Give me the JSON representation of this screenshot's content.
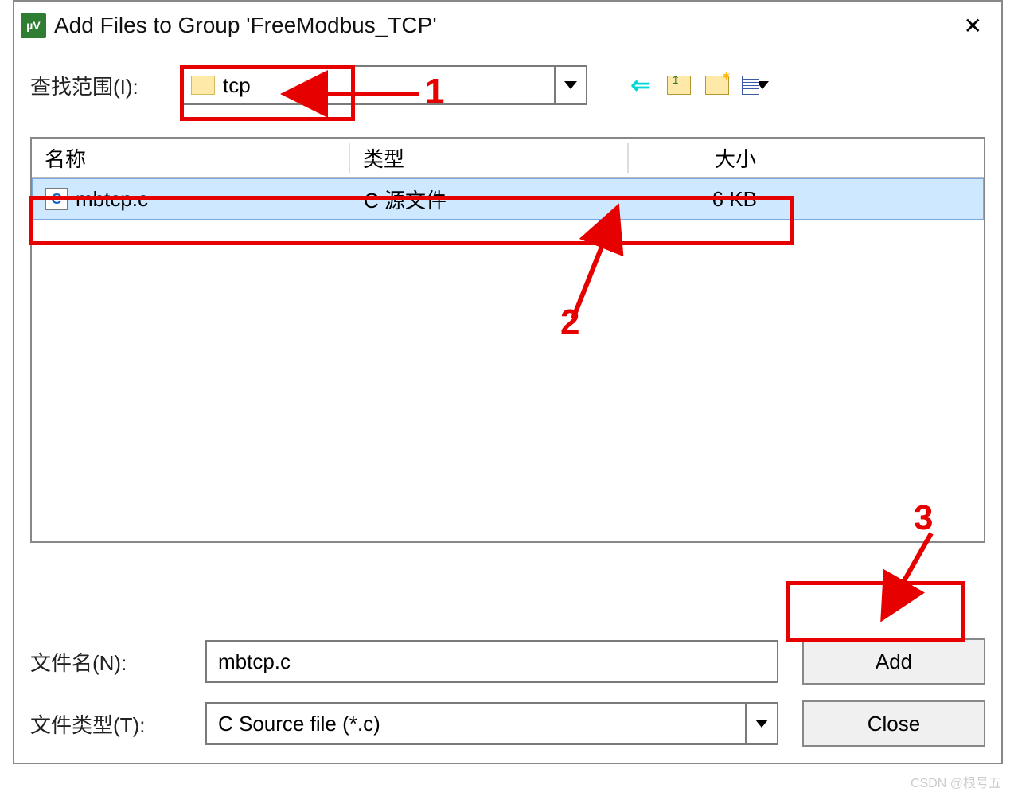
{
  "title": "Add Files to Group 'FreeModbus_TCP'",
  "lookin_label": "查找范围(I):",
  "lookin_value": "tcp",
  "columns": {
    "name": "名称",
    "type": "类型",
    "size": "大小"
  },
  "files": [
    {
      "icon": "C",
      "name": "mbtcp.c",
      "type": "C 源文件",
      "size": "6 KB"
    }
  ],
  "filename_label": "文件名(N):",
  "filename_value": "mbtcp.c",
  "filetype_label": "文件类型(T):",
  "filetype_value": "C Source file (*.c)",
  "add_button": "Add",
  "close_button": "Close",
  "annotations": {
    "n1": "1",
    "n2": "2",
    "n3": "3"
  },
  "watermark": "CSDN @根号五"
}
